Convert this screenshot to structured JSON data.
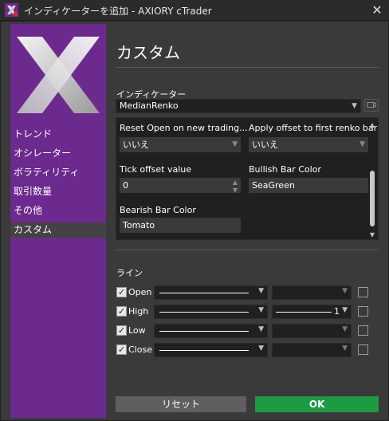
{
  "window": {
    "title": "インディケーターを追加 - AXIORY cTrader",
    "close_label": "✕"
  },
  "sidebar": {
    "items": [
      {
        "label": "トレンド"
      },
      {
        "label": "オシレーター"
      },
      {
        "label": "ボラティリティ"
      },
      {
        "label": "取引数量"
      },
      {
        "label": "その他"
      },
      {
        "label": "カスタム",
        "active": true
      }
    ]
  },
  "main": {
    "title": "カスタム",
    "indicator_label": "インディケーター",
    "indicator_value": "MedianRenko"
  },
  "params": {
    "reset_open_label": "Reset Open on new trading...",
    "reset_open_value": "いいえ",
    "apply_offset_label": "Apply offset to first renko bar",
    "apply_offset_value": "いいえ",
    "tick_offset_label": "Tick offset value",
    "tick_offset_value": "0",
    "bullish_label": "Bullish Bar Color",
    "bullish_value": "SeaGreen",
    "bearish_label": "Bearish Bar Color",
    "bearish_value": "Tomato"
  },
  "lines": {
    "section_label": "ライン",
    "rows": [
      {
        "label": "Open",
        "checked": true,
        "width": ""
      },
      {
        "label": "High",
        "checked": true,
        "width": "1"
      },
      {
        "label": "Low",
        "checked": true,
        "width": ""
      },
      {
        "label": "Close",
        "checked": true,
        "width": ""
      }
    ]
  },
  "buttons": {
    "reset_label": "リセット",
    "ok_label": "OK"
  },
  "colors": {
    "sidebar": "#6c2a8e",
    "ok": "#1d9b43",
    "background": "#3a3a3a"
  }
}
